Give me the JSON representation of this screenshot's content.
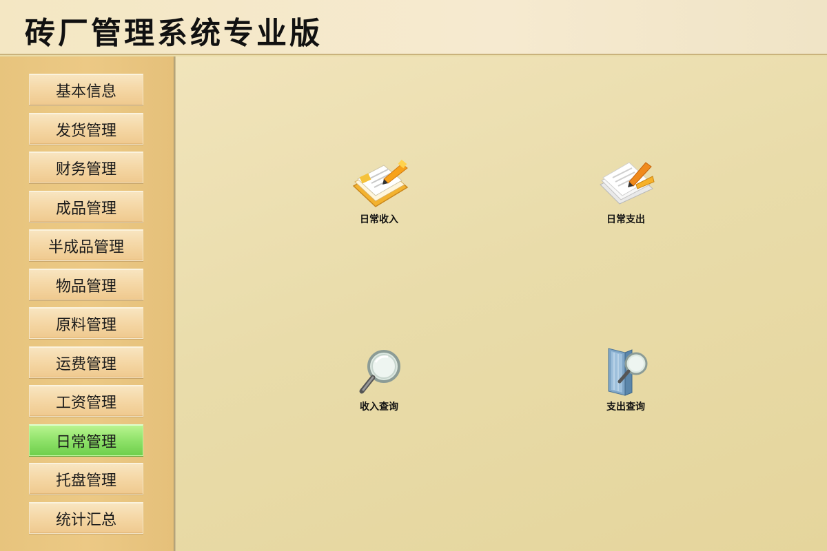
{
  "header": {
    "title": "砖厂管理系统专业版"
  },
  "sidebar": {
    "items": [
      {
        "label": "基本信息"
      },
      {
        "label": "发货管理"
      },
      {
        "label": "财务管理"
      },
      {
        "label": "成品管理"
      },
      {
        "label": "半成品管理"
      },
      {
        "label": "物品管理"
      },
      {
        "label": "原料管理"
      },
      {
        "label": "运费管理"
      },
      {
        "label": "工资管理"
      },
      {
        "label": "日常管理",
        "active": true
      },
      {
        "label": "托盘管理"
      },
      {
        "label": "统计汇总"
      }
    ]
  },
  "main": {
    "tiles": [
      {
        "label": "日常收入",
        "icon": "income-notebook-icon"
      },
      {
        "label": "日常支出",
        "icon": "expense-papers-icon"
      },
      {
        "label": "收入查询",
        "icon": "magnifier-icon"
      },
      {
        "label": "支出查询",
        "icon": "book-search-icon"
      }
    ]
  },
  "colors": {
    "active_menu": "#8fe26a",
    "menu_item": "#f5d8a7",
    "sidebar": "#ecc985",
    "content_bg": "#e9dcaa"
  }
}
